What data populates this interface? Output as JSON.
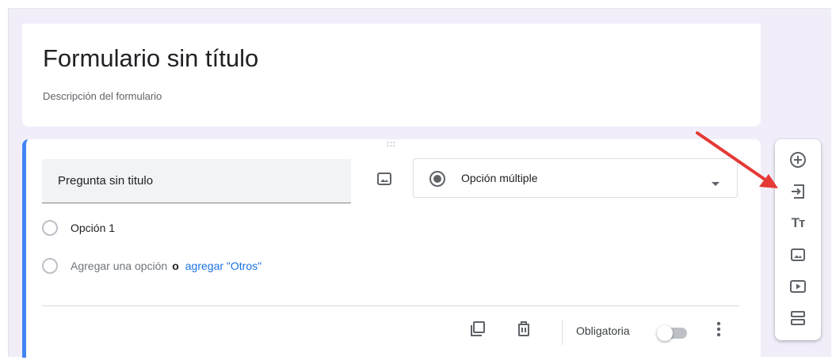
{
  "form": {
    "title": "Formulario sin título",
    "description": "Descripción del formulario"
  },
  "question": {
    "title": "Pregunta sin titulo",
    "type_label": "Opción múltiple",
    "options": [
      {
        "label": "Opción 1"
      }
    ],
    "add_option_label": "Agregar una opción",
    "or_label": "o",
    "add_other_label": "agregar \"Otros\"",
    "required_label": "Obligatoria",
    "required_on": false
  },
  "icons": {
    "drag": "drag-handle-icon",
    "image": "image-icon",
    "radio": "radio-selected-icon",
    "caret": "caret-down-icon",
    "duplicate": "duplicate-icon",
    "delete": "trash-icon",
    "more": "more-vert-icon"
  },
  "toolbar": {
    "items": [
      "add-question-icon",
      "import-questions-icon",
      "title-text-icon",
      "image-icon",
      "video-icon",
      "section-icon"
    ]
  },
  "colors": {
    "accent": "#4285f4",
    "link": "#1a73e8",
    "annotation_arrow": "#e53935",
    "background": "#f1eefa"
  }
}
